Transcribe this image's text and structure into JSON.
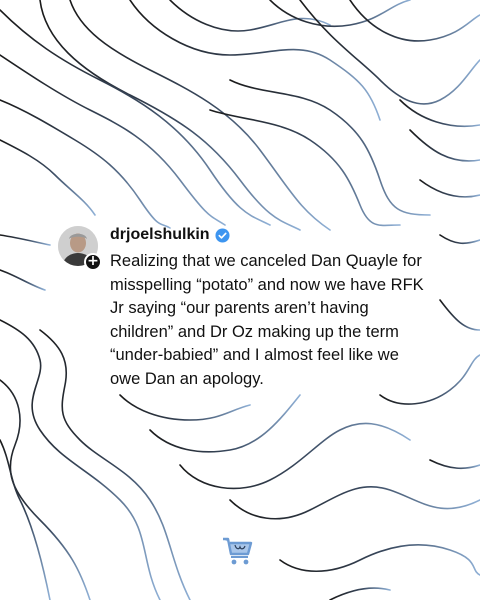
{
  "post": {
    "username": "drjoelshulkin",
    "verified": true,
    "text": "Realizing that we canceled Dan Quayle for misspelling “potato” and now we have RFK Jr saying “our parents aren’t having children” and Dr Oz making up the term “under-babied” and I almost feel like we owe Dan an apology.",
    "follow_glyph": "+"
  },
  "icons": {
    "avatar": "profile-photo",
    "verified": "verified-badge-icon",
    "watermark": "shopping-cart-logo-icon"
  },
  "colors": {
    "line_dark": "#1a1a1a",
    "line_light": "#8fb0d6",
    "verified_blue": "#3d95f0",
    "cart_blue": "#6d9bd3"
  }
}
